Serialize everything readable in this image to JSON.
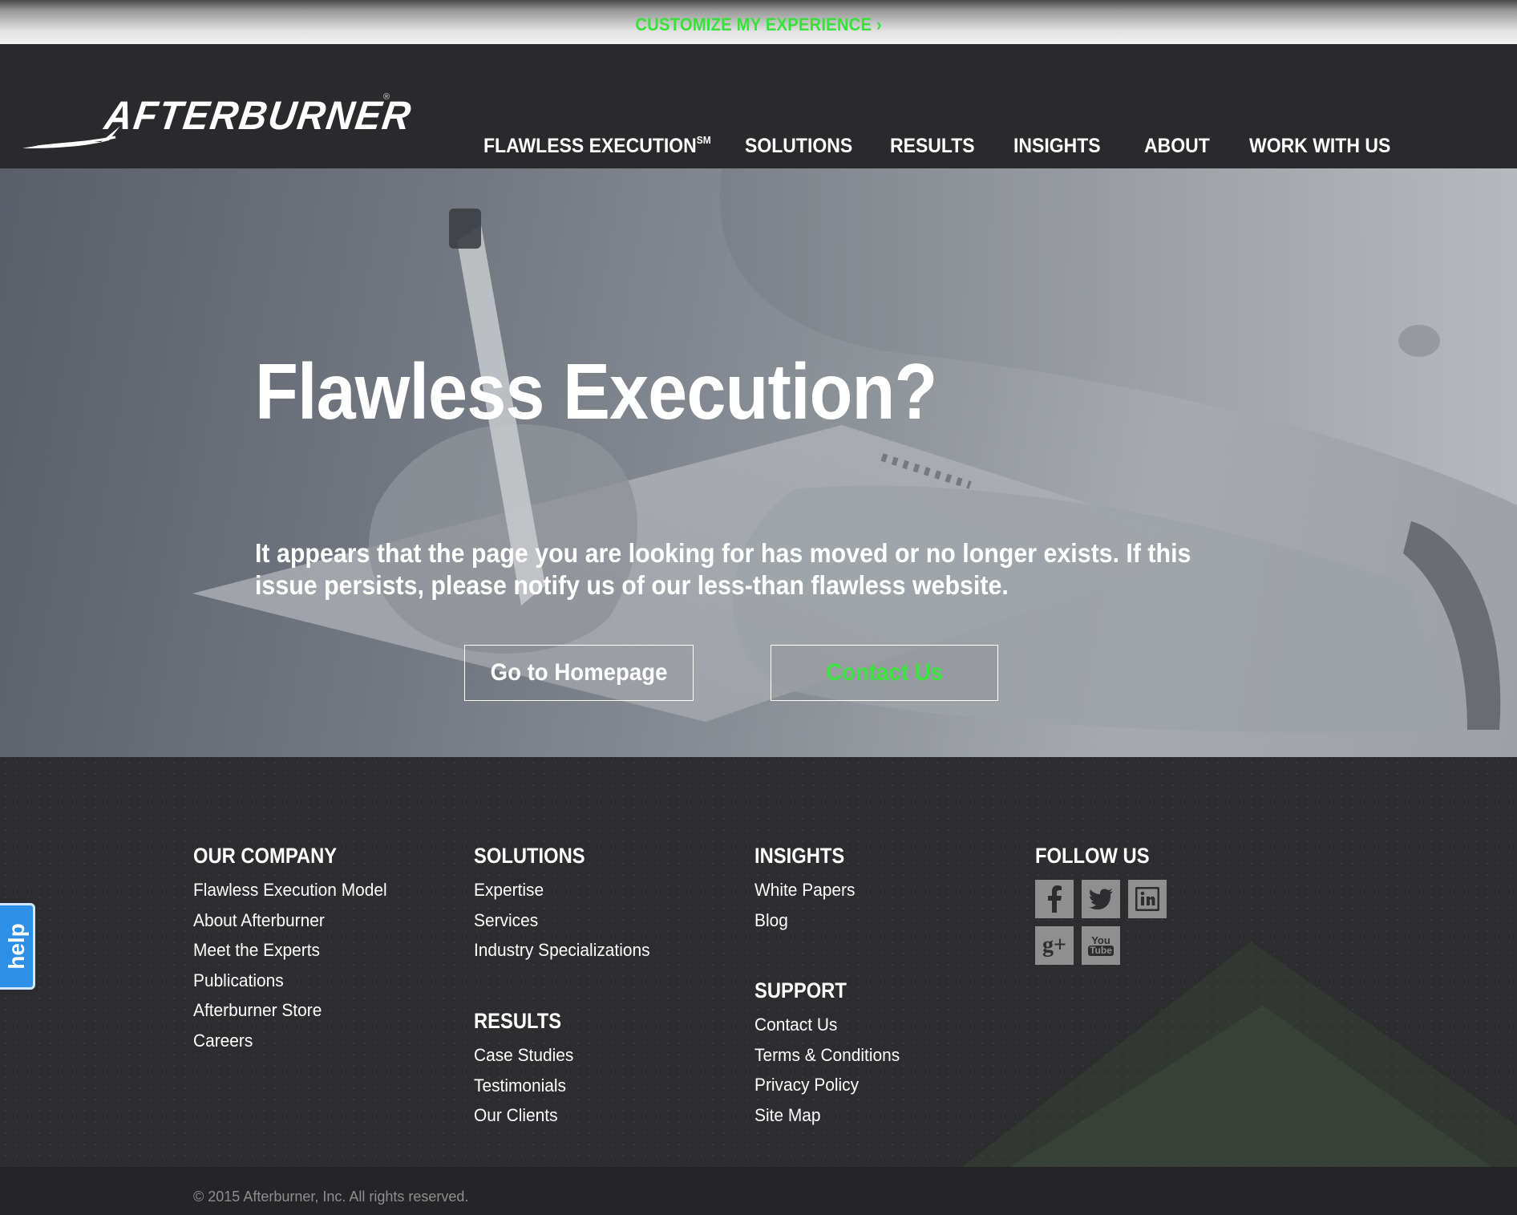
{
  "topbar": {
    "customize_label": "CUSTOMIZE MY EXPERIENCE ›"
  },
  "brand": {
    "name": "AFTERBURNER",
    "reg_mark": "®"
  },
  "nav": {
    "items": [
      {
        "label": "FLAWLESS EXECUTION",
        "sup": "SM"
      },
      {
        "label": "SOLUTIONS"
      },
      {
        "label": "RESULTS"
      },
      {
        "label": "INSIGHTS"
      },
      {
        "label": "ABOUT"
      },
      {
        "label": "WORK WITH US"
      }
    ]
  },
  "hero": {
    "title": "Flawless Execution?",
    "message": "It appears that the page you are looking for has moved or no longer exists. If this issue persists, please notify us of our less-than flawless website.",
    "home_button": "Go to Homepage",
    "contact_button": "Contact Us"
  },
  "footer": {
    "company": {
      "heading": "OUR COMPANY",
      "links": [
        "Flawless Execution Model",
        "About Afterburner",
        "Meet the Experts",
        "Publications",
        "Afterburner Store",
        "Careers"
      ]
    },
    "solutions": {
      "heading": "SOLUTIONS",
      "links": [
        "Expertise",
        "Services",
        "Industry Specializations"
      ]
    },
    "results": {
      "heading": "RESULTS",
      "links": [
        "Case Studies",
        "Testimonials",
        "Our Clients"
      ]
    },
    "insights": {
      "heading": "INSIGHTS",
      "links": [
        "White Papers",
        "Blog"
      ]
    },
    "support": {
      "heading": "SUPPORT",
      "links": [
        "Contact Us",
        "Terms & Conditions",
        "Privacy Policy",
        "Site Map"
      ]
    },
    "follow": {
      "heading": "FOLLOW US",
      "icons": [
        "facebook-icon",
        "twitter-icon",
        "linkedin-icon",
        "google-plus-icon",
        "youtube-icon"
      ],
      "google_label": "g+",
      "youtube_top": "You",
      "youtube_bottom": "Tube"
    }
  },
  "help": {
    "label": "help"
  },
  "copyright": "© 2015 Afterburner, Inc. All rights reserved.",
  "colors": {
    "accent_green": "#39e03b",
    "help_blue": "#2e8fe6",
    "footer_bg": "#2d2d2f",
    "header_bg": "#2a2a2c"
  }
}
